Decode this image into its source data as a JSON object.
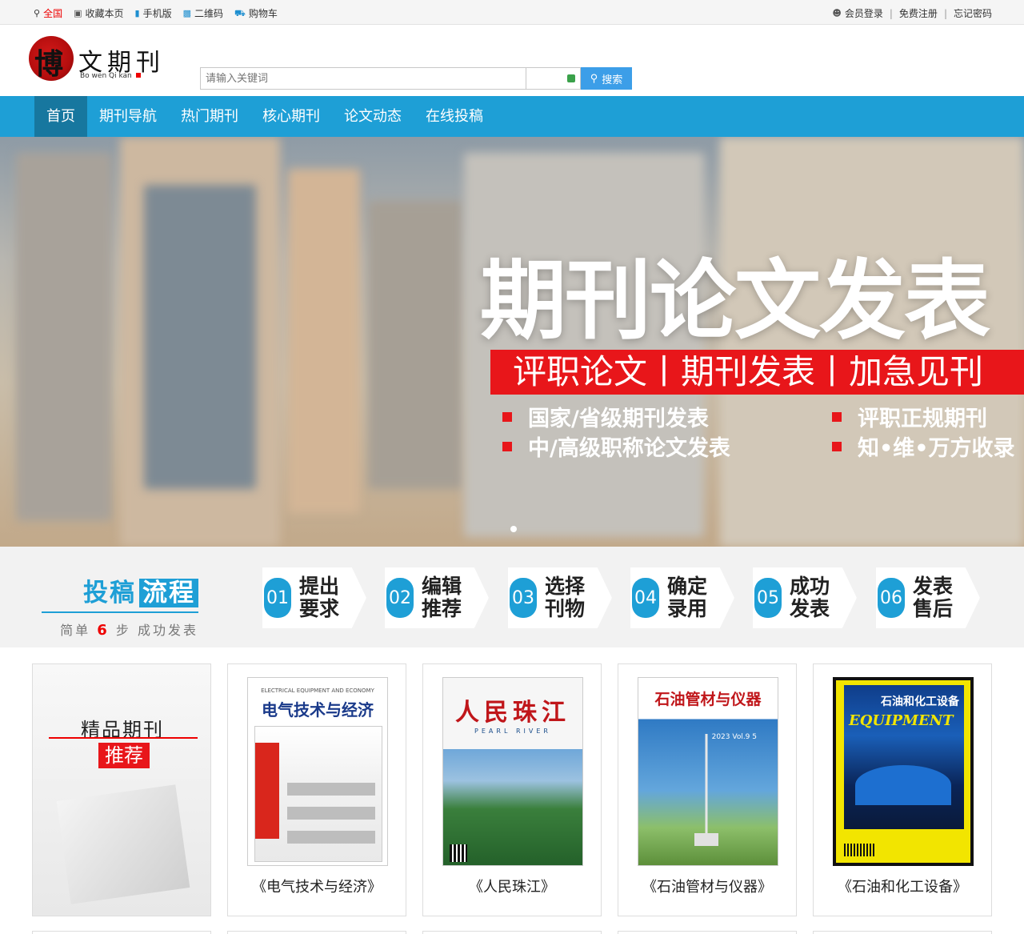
{
  "topbar": {
    "left": [
      {
        "icon": "location-icon",
        "label": "全国"
      },
      {
        "icon": "bookmark-icon",
        "label": "收藏本页"
      },
      {
        "icon": "mobile-icon",
        "label": "手机版"
      },
      {
        "icon": "qrcode-icon",
        "label": "二维码"
      },
      {
        "icon": "cart-icon",
        "label": "购物车"
      }
    ],
    "right": [
      {
        "icon": "user-icon",
        "label": "会员登录"
      },
      {
        "label": "免费注册"
      },
      {
        "label": "忘记密码"
      }
    ],
    "separator": "|"
  },
  "logo": {
    "char": "博",
    "text": "文期刊",
    "sub": "Bo wen Qi kan"
  },
  "search": {
    "placeholder": "请输入关键词",
    "button_label": "搜索"
  },
  "nav": {
    "items": [
      "首页",
      "期刊导航",
      "热门期刊",
      "核心期刊",
      "论文动态",
      "在线投稿"
    ],
    "active": 0
  },
  "banner": {
    "title": "期刊论文发表",
    "strip": "评职论文丨期刊发表丨加急见刊",
    "bullets": [
      "国家/省级期刊发表",
      "评职正规期刊",
      "中/高级职称论文发表",
      "知•维•万方收录"
    ]
  },
  "process": {
    "title_a": "投稿",
    "title_b": "流程",
    "sub_prefix": "简单",
    "sub_num": "6",
    "sub_suffix": "步  成功发表",
    "steps": [
      {
        "num": "01",
        "text": "提出要求"
      },
      {
        "num": "02",
        "text": "编辑推荐"
      },
      {
        "num": "03",
        "text": "选择刊物"
      },
      {
        "num": "04",
        "text": "确定录用"
      },
      {
        "num": "05",
        "text": "成功发表"
      },
      {
        "num": "06",
        "text": "发表售后"
      }
    ]
  },
  "recommend": {
    "title": "精品期刊",
    "tag": "推荐"
  },
  "journals": [
    {
      "name": "《电气技术与经济》",
      "cover_title": "电气技术与经济",
      "cover_en": "ELECTRICAL EQUIPMENT AND ECONOMY"
    },
    {
      "name": "《人民珠江》",
      "cover_title": "人民珠江",
      "cover_en": "PEARL RIVER"
    },
    {
      "name": "《石油管材与仪器》",
      "cover_title": "石油管材与仪器",
      "cover_en": "2023 Vol.9 5"
    },
    {
      "name": "《石油和化工设备》",
      "cover_title": "石油和化工设备",
      "cover_en": "EQUIPMENT"
    }
  ],
  "colors": {
    "accent": "#1e9fd6",
    "red": "#e8161a",
    "nav_active": "#17779f"
  }
}
